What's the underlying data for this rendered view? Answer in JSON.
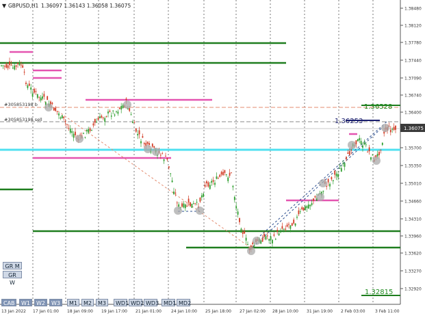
{
  "header": {
    "symbol_label": "GBPUSD,H1",
    "ohlc": "1.36097 1.36143 1.36058 1.36075"
  },
  "annotations": {
    "buy_order": "#305853198 b",
    "sell_order": "#305853198 sell",
    "price_1": "1.36528",
    "price_2": "1.36253",
    "price_3": "1.32815"
  },
  "price_axis": {
    "ticks": [
      "1.38480",
      "1.38120",
      "1.37780",
      "1.37440",
      "1.37090",
      "1.36740",
      "1.36400",
      "1.35700",
      "1.35350",
      "1.35010",
      "1.34660",
      "1.34310",
      "1.33960",
      "1.33620",
      "1.33270",
      "1.32920",
      "1.32580"
    ],
    "current_price": "1.36075"
  },
  "time_axis": {
    "labels": [
      "13 Jan 2022",
      "17 Jan 01:00",
      "18 Jan 09:00",
      "19 Jan 17:00",
      "21 Jan 01:00",
      "24 Jan 10:00",
      "25 Jan 18:00",
      "27 Jan 02:00",
      "28 Jan 10:00",
      "31 Jan 19:00",
      "2 Feb 03:00",
      "3 Feb 11:00"
    ]
  },
  "toolbar": {
    "side_buttons": [
      "GR M",
      "GR W"
    ],
    "bottom_buttons": [
      "CAB",
      "W1",
      "W2",
      "W3",
      "M1",
      "M2",
      "M3",
      "WD1",
      "WD2",
      "WD3",
      "MD1",
      "MD2"
    ]
  },
  "colors": {
    "bull": "#2e9e2e",
    "bear": "#d23b24",
    "support": "#1e7d1e",
    "zone": "#e454b0",
    "cyan": "#4fe0f0",
    "navy": "#1a1e6e"
  }
}
